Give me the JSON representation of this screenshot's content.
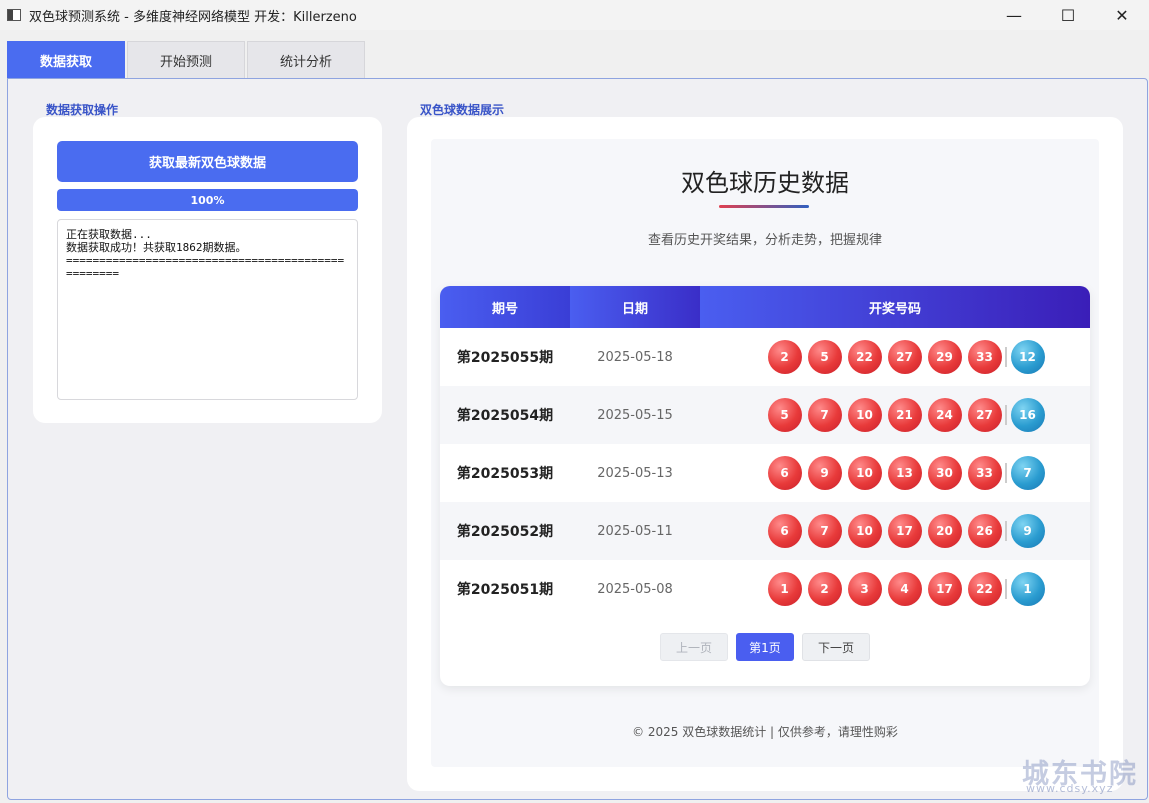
{
  "window": {
    "title": "双色球预测系统 - 多维度神经网络模型 开发：Killerzeno",
    "minimize": "—",
    "maximize": "☐",
    "close": "✕"
  },
  "tabs": [
    {
      "label": "数据获取",
      "active": true
    },
    {
      "label": "开始预测",
      "active": false
    },
    {
      "label": "统计分析",
      "active": false
    }
  ],
  "left": {
    "group_title": "数据获取操作",
    "fetch_button": "获取最新双色球数据",
    "progress_text": "100%",
    "progress_value": 1.0,
    "log_text": "正在获取数据...\n数据获取成功！共获取1862期数据。\n=================================================="
  },
  "right": {
    "group_title": "双色球数据展示",
    "heading": "双色球历史数据",
    "subtitle": "查看历史开奖结果，分析走势，把握规律",
    "columns": [
      "期号",
      "日期",
      "开奖号码"
    ],
    "rows": [
      {
        "issue": "第2025055期",
        "date": "2025-05-18",
        "red": [
          "2",
          "5",
          "22",
          "27",
          "29",
          "33"
        ],
        "blue": "12"
      },
      {
        "issue": "第2025054期",
        "date": "2025-05-15",
        "red": [
          "5",
          "7",
          "10",
          "21",
          "24",
          "27"
        ],
        "blue": "16"
      },
      {
        "issue": "第2025053期",
        "date": "2025-05-13",
        "red": [
          "6",
          "9",
          "10",
          "13",
          "30",
          "33"
        ],
        "blue": "7"
      },
      {
        "issue": "第2025052期",
        "date": "2025-05-11",
        "red": [
          "6",
          "7",
          "10",
          "17",
          "20",
          "26"
        ],
        "blue": "9"
      },
      {
        "issue": "第2025051期",
        "date": "2025-05-08",
        "red": [
          "1",
          "2",
          "3",
          "4",
          "17",
          "22"
        ],
        "blue": "1"
      }
    ],
    "pager": {
      "prev": "上一页",
      "current": "第1页",
      "next": "下一页"
    },
    "footer": "© 2025 双色球数据统计 | 仅供参考，请理性购彩"
  },
  "watermark": {
    "text": "城东书院",
    "url": "www.cdsy.xyz"
  },
  "colors": {
    "accent": "#4a6cf0",
    "red_ball": "#e83a3a",
    "blue_ball": "#2a9cd0"
  }
}
